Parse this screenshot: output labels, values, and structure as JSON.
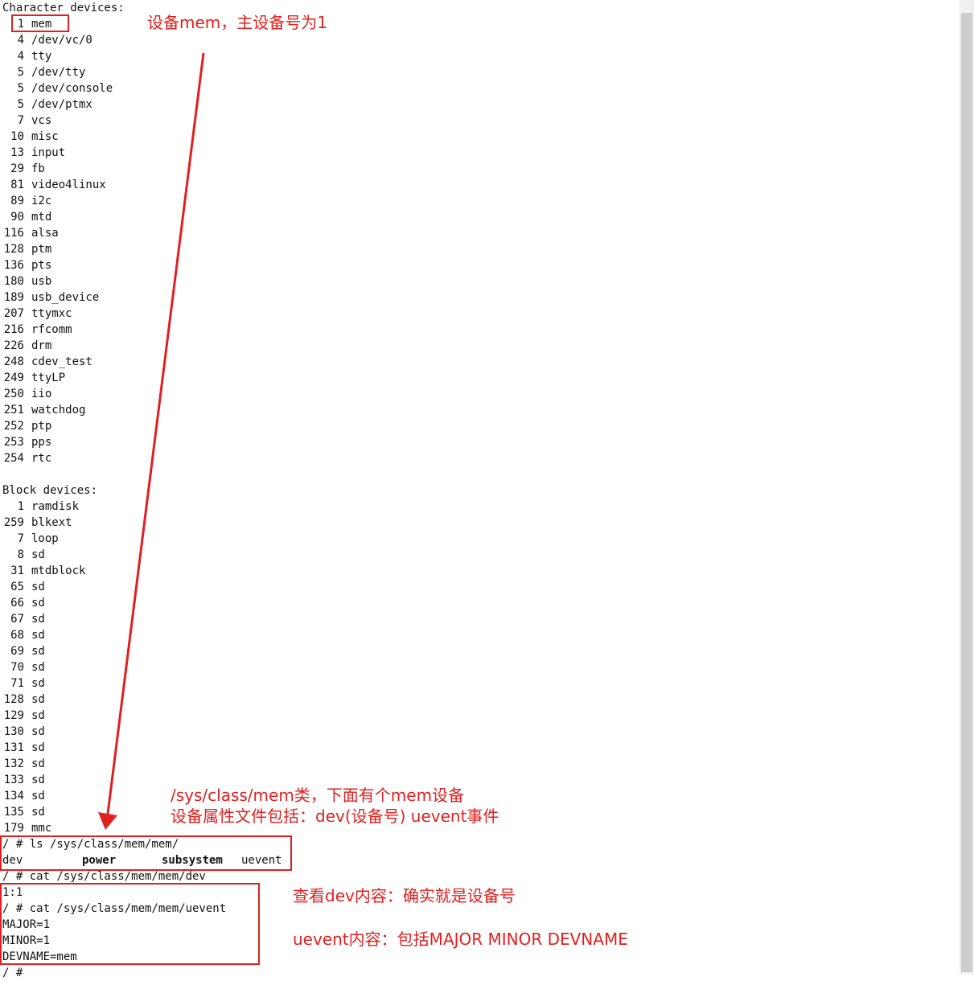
{
  "terminal": {
    "char_header": "Character devices:",
    "char_devices": [
      {
        "num": "1",
        "name": "mem"
      },
      {
        "num": "4",
        "name": "/dev/vc/0"
      },
      {
        "num": "4",
        "name": "tty"
      },
      {
        "num": "5",
        "name": "/dev/tty"
      },
      {
        "num": "5",
        "name": "/dev/console"
      },
      {
        "num": "5",
        "name": "/dev/ptmx"
      },
      {
        "num": "7",
        "name": "vcs"
      },
      {
        "num": "10",
        "name": "misc"
      },
      {
        "num": "13",
        "name": "input"
      },
      {
        "num": "29",
        "name": "fb"
      },
      {
        "num": "81",
        "name": "video4linux"
      },
      {
        "num": "89",
        "name": "i2c"
      },
      {
        "num": "90",
        "name": "mtd"
      },
      {
        "num": "116",
        "name": "alsa"
      },
      {
        "num": "128",
        "name": "ptm"
      },
      {
        "num": "136",
        "name": "pts"
      },
      {
        "num": "180",
        "name": "usb"
      },
      {
        "num": "189",
        "name": "usb_device"
      },
      {
        "num": "207",
        "name": "ttymxc"
      },
      {
        "num": "216",
        "name": "rfcomm"
      },
      {
        "num": "226",
        "name": "drm"
      },
      {
        "num": "248",
        "name": "cdev_test"
      },
      {
        "num": "249",
        "name": "ttyLP"
      },
      {
        "num": "250",
        "name": "iio"
      },
      {
        "num": "251",
        "name": "watchdog"
      },
      {
        "num": "252",
        "name": "ptp"
      },
      {
        "num": "253",
        "name": "pps"
      },
      {
        "num": "254",
        "name": "rtc"
      }
    ],
    "block_header": "Block devices:",
    "block_devices": [
      {
        "num": "1",
        "name": "ramdisk"
      },
      {
        "num": "259",
        "name": "blkext"
      },
      {
        "num": "7",
        "name": "loop"
      },
      {
        "num": "8",
        "name": "sd"
      },
      {
        "num": "31",
        "name": "mtdblock"
      },
      {
        "num": "65",
        "name": "sd"
      },
      {
        "num": "66",
        "name": "sd"
      },
      {
        "num": "67",
        "name": "sd"
      },
      {
        "num": "68",
        "name": "sd"
      },
      {
        "num": "69",
        "name": "sd"
      },
      {
        "num": "70",
        "name": "sd"
      },
      {
        "num": "71",
        "name": "sd"
      },
      {
        "num": "128",
        "name": "sd"
      },
      {
        "num": "129",
        "name": "sd"
      },
      {
        "num": "130",
        "name": "sd"
      },
      {
        "num": "131",
        "name": "sd"
      },
      {
        "num": "132",
        "name": "sd"
      },
      {
        "num": "133",
        "name": "sd"
      },
      {
        "num": "134",
        "name": "sd"
      },
      {
        "num": "135",
        "name": "sd"
      },
      {
        "num": "179",
        "name": "mmc"
      }
    ],
    "cmd_ls": "/ # ls /sys/class/mem/mem/",
    "ls_output": [
      "dev",
      "power",
      "subsystem",
      "uevent"
    ],
    "cmd_cat_dev": "/ # cat /sys/class/mem/mem/dev",
    "dev_output": "1:1",
    "cmd_cat_uevent": "/ # cat /sys/class/mem/mem/uevent",
    "uevent_lines": [
      "MAJOR=1",
      "MINOR=1",
      "DEVNAME=mem"
    ],
    "prompt": "/ #"
  },
  "annotations": {
    "mem_note": "设备mem，主设备号为1",
    "class_note_1": "/sys/class/mem类，下面有个mem设备",
    "class_note_2": "设备属性文件包括：dev(设备号) uevent事件",
    "dev_note": "查看dev内容：确实就是设备号",
    "uevent_note": "uevent内容：包括MAJOR MINOR DEVNAME"
  },
  "colors": {
    "annotation": "#e02020",
    "text": "#111111"
  }
}
